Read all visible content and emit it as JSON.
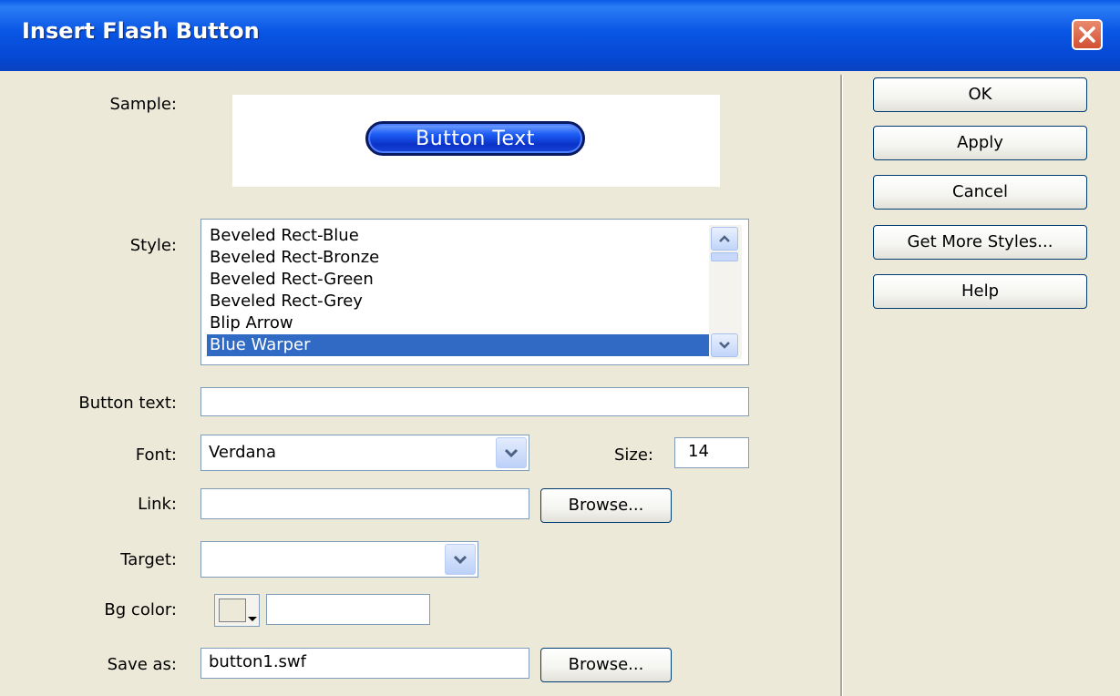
{
  "window": {
    "title": "Insert Flash Button"
  },
  "sample": {
    "label": "Sample:",
    "button_text": "Button Text"
  },
  "style": {
    "label": "Style:",
    "items": [
      "Beveled Rect-Blue",
      "Beveled Rect-Bronze",
      "Beveled Rect-Green",
      "Beveled Rect-Grey",
      "Blip Arrow",
      "Blue Warper"
    ],
    "selected": "Blue Warper"
  },
  "button_text": {
    "label": "Button text:",
    "value": ""
  },
  "font": {
    "label": "Font:",
    "value": "Verdana"
  },
  "size": {
    "label": "Size:",
    "value": "14"
  },
  "link": {
    "label": "Link:",
    "value": "",
    "browse_label": "Browse..."
  },
  "target": {
    "label": "Target:",
    "value": ""
  },
  "bg_color": {
    "label": "Bg color:",
    "value": ""
  },
  "save_as": {
    "label": "Save as:",
    "value": "button1.swf",
    "browse_label": "Browse..."
  },
  "actions": {
    "ok": "OK",
    "apply": "Apply",
    "cancel": "Cancel",
    "get_more_styles": "Get More Styles...",
    "help": "Help"
  },
  "colors": {
    "titlebar": "#0955e4",
    "selection": "#316ac5",
    "dialog_bg": "#ece9d8",
    "close": "#d25033"
  },
  "icons": {
    "close": "close-icon",
    "dropdown": "chevron-down-icon",
    "scroll_up": "chevron-up-icon",
    "scroll_down": "chevron-down-icon"
  }
}
